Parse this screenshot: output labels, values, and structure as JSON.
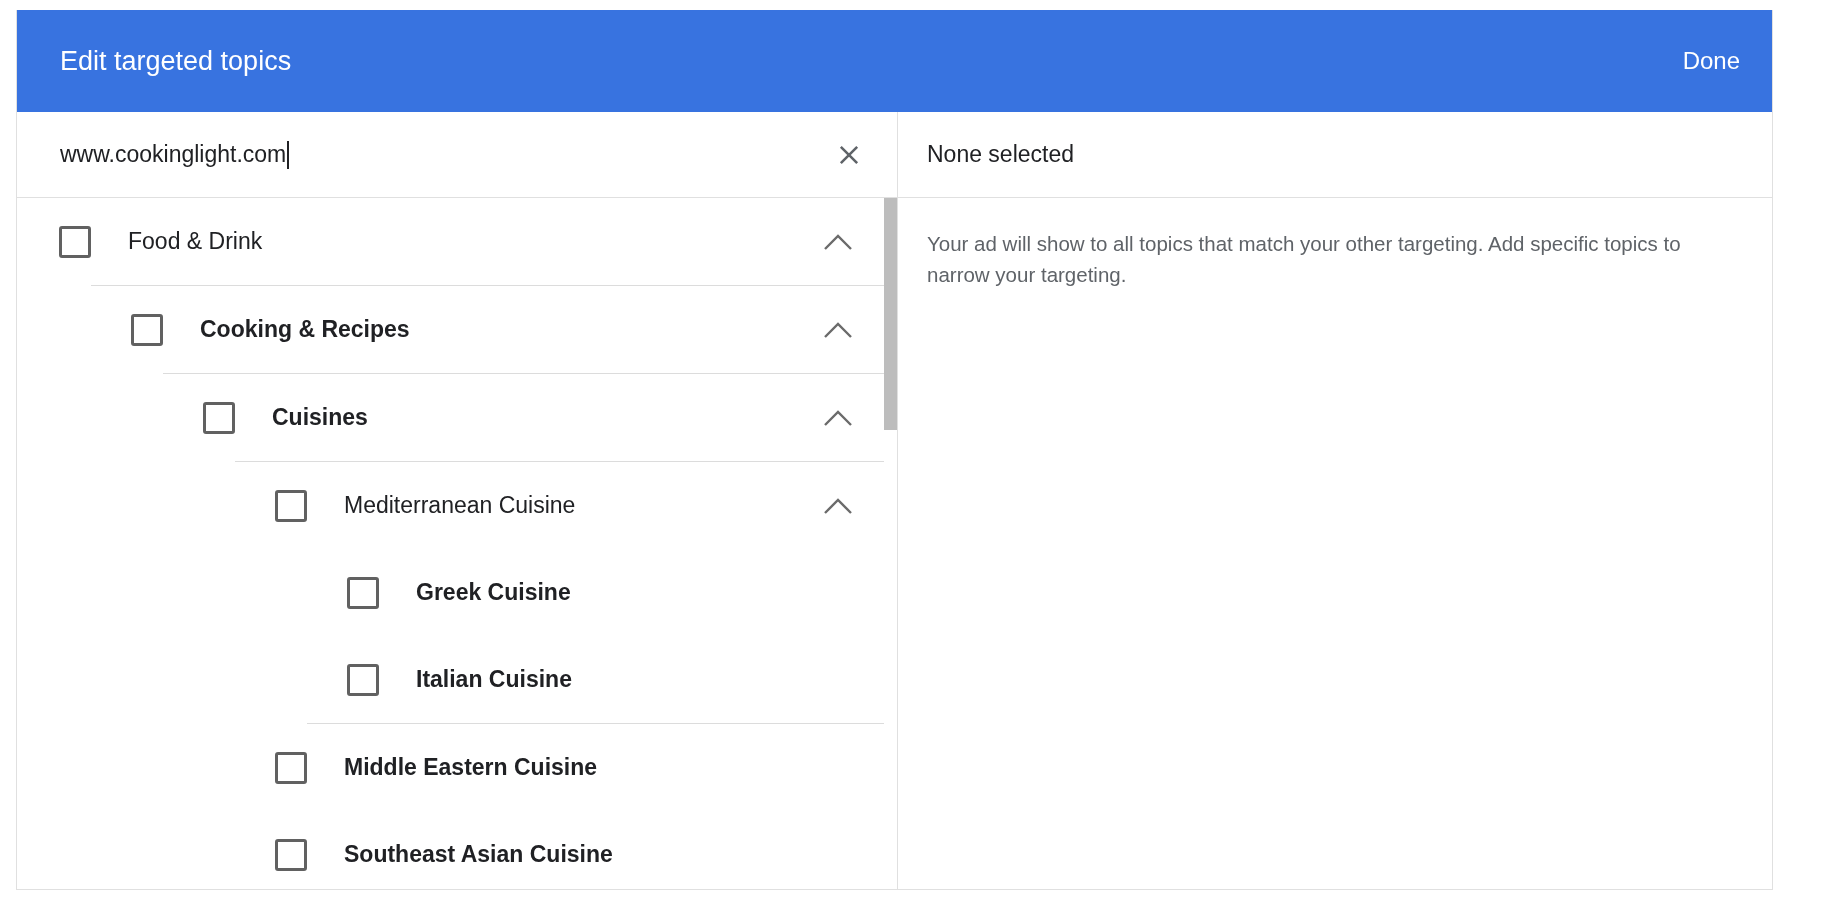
{
  "dialog": {
    "title": "Edit targeted topics",
    "done_button": "Done"
  },
  "search": {
    "value": "www.cookinglight.com"
  },
  "tree": [
    {
      "label": "Food & Drink",
      "checked": false,
      "bold": false,
      "expanded": true,
      "children": [
        {
          "label": "Cooking & Recipes",
          "checked": false,
          "bold": true,
          "expanded": true,
          "children": [
            {
              "label": "Cuisines",
              "checked": false,
              "bold": true,
              "expanded": true,
              "children": [
                {
                  "label": "Mediterranean Cuisine",
                  "checked": false,
                  "bold": false,
                  "expanded": true,
                  "children": [
                    {
                      "label": "Greek Cuisine",
                      "checked": false,
                      "bold": true
                    },
                    {
                      "label": "Italian Cuisine",
                      "checked": false,
                      "bold": true
                    }
                  ]
                },
                {
                  "label": "Middle Eastern Cuisine",
                  "checked": false,
                  "bold": true
                },
                {
                  "label": "Southeast Asian Cuisine",
                  "checked": false,
                  "bold": true
                }
              ]
            }
          ]
        }
      ]
    }
  ],
  "selection": {
    "heading": "None selected",
    "note": "Your ad will show to all topics that match your other targeting. Add specific topics to narrow your targeting."
  }
}
